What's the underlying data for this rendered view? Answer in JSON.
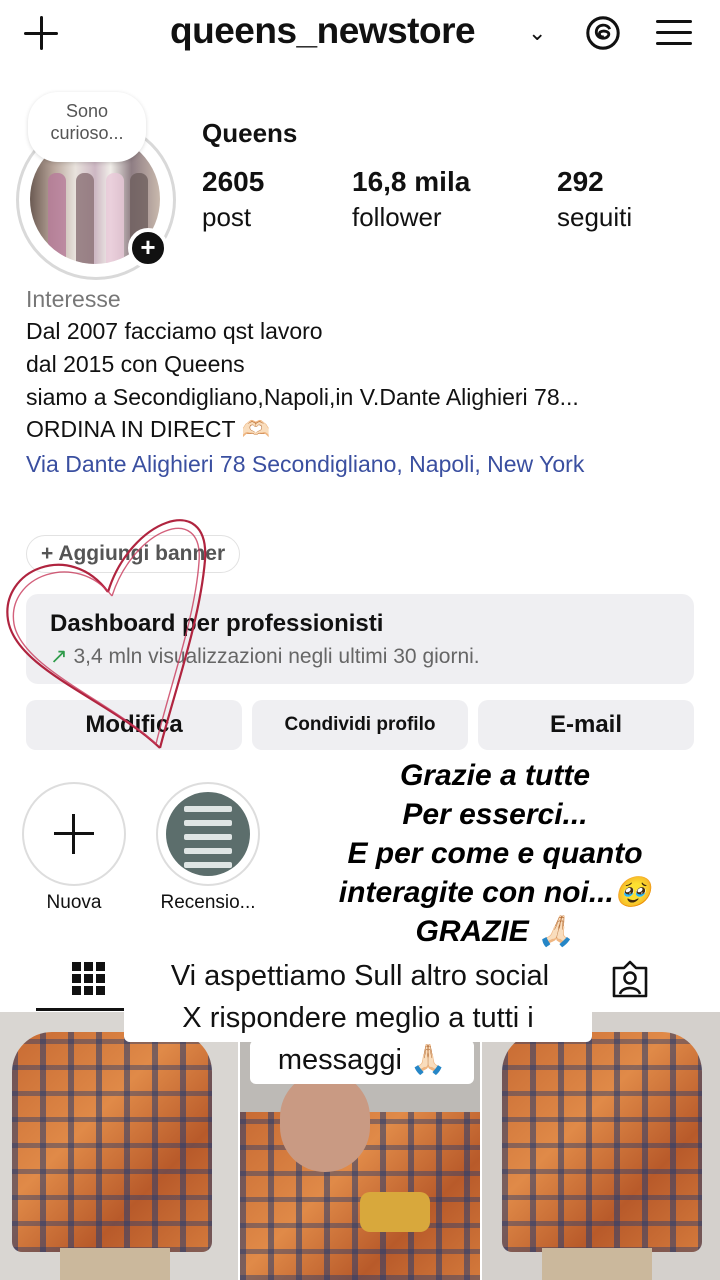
{
  "header": {
    "username": "queens_newstore",
    "dropdown_icon": "chevron-down-icon",
    "create_icon": "plus-icon",
    "threads_icon": "threads-icon",
    "menu_icon": "hamburger-menu-icon"
  },
  "profile": {
    "note": "Sono curioso...",
    "name": "Queens",
    "stats": [
      {
        "value": "2605",
        "label": "post"
      },
      {
        "value": "16,8 mila",
        "label": "follower"
      },
      {
        "value": "292",
        "label": "seguiti"
      }
    ],
    "category": "Interesse",
    "bio": [
      "Dal 2007 facciamo qst lavoro",
      "dal 2015 con Queens",
      "siamo a Secondigliano,Napoli,in V.Dante Alighieri 78...",
      "ORDINA IN DIRECT 🫶🏻"
    ],
    "address": "Via Dante Alighieri 78 Secondigliano, Napoli, New York",
    "add_banner": "+ Aggiungi banner"
  },
  "dashboard": {
    "title": "Dashboard per professionisti",
    "arrow": "↗",
    "subtitle": "3,4 mln visualizzazioni negli ultimi 30 giorni."
  },
  "actions": {
    "edit": "Modifica",
    "share": "Condividi profilo",
    "email": "E-mail"
  },
  "highlights": [
    {
      "label": "Nuova"
    },
    {
      "label": "Recensio..."
    }
  ],
  "overlay": {
    "thanks": [
      "Grazie a tutte",
      "Per esserci...",
      "E per come e quanto",
      "interagite con noi...🥹",
      "GRAZIE 🙏🏻"
    ],
    "caption": [
      "Vi aspettiamo Sull altro social",
      "X rispondere meglio a tutti i",
      "messaggi 🙏🏻"
    ]
  },
  "tabs": {
    "grid_icon": "grid-icon",
    "tagged_icon": "tagged-person-icon"
  },
  "colors": {
    "link": "#3a4fa0",
    "button_bg": "#efeff2",
    "heart_stroke": "#b0243f",
    "growth_arrow": "#2e9b4a"
  }
}
